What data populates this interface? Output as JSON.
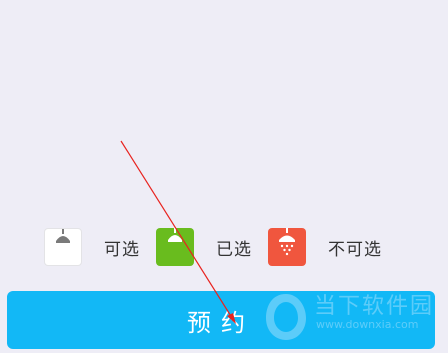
{
  "legend": {
    "available": {
      "label": "可选",
      "icon": "shower-icon",
      "color": "#ffffff"
    },
    "selected": {
      "label": "已选",
      "icon": "shower-icon",
      "color": "#69bc1e"
    },
    "unavailable": {
      "label": "不可选",
      "icon": "shower-icon",
      "color": "#f0563e"
    }
  },
  "reserve": {
    "label": "预约",
    "color": "#12b8f6"
  },
  "watermark": {
    "logo": "当下软件园",
    "site": "www.downxia.com"
  },
  "annotation": {
    "icon": "red-arrow-annotation",
    "color": "#e8231f"
  }
}
